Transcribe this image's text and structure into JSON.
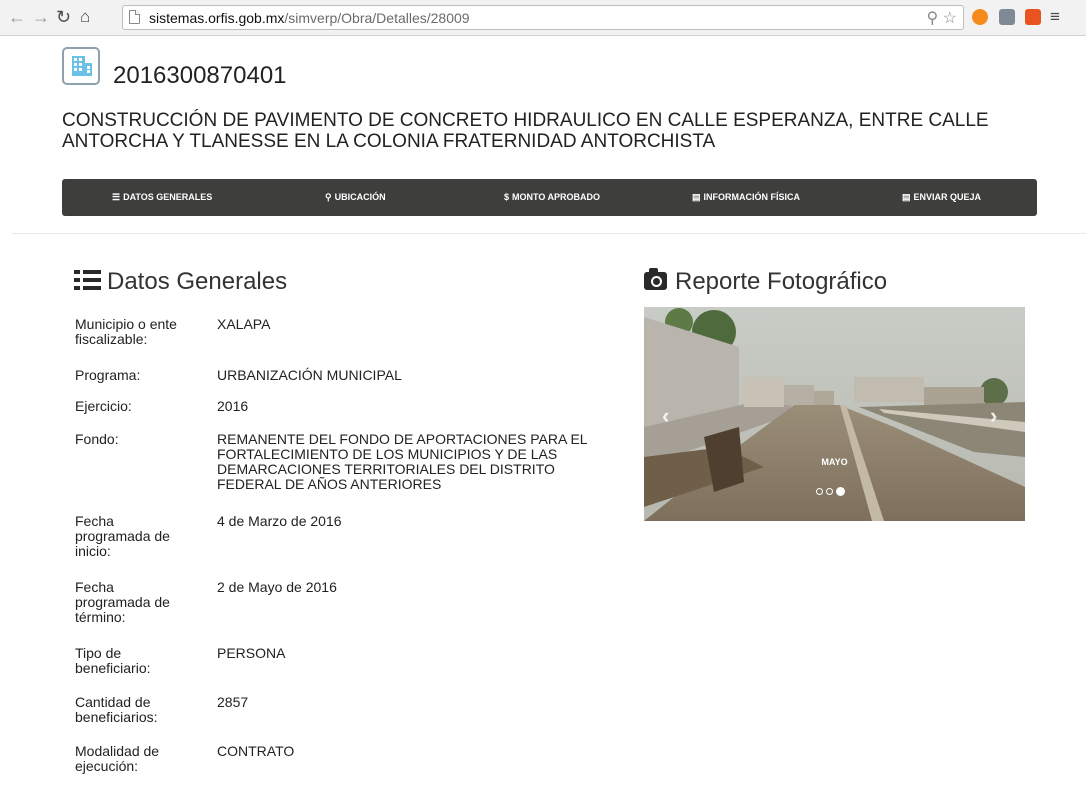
{
  "browser": {
    "url_host": "sistemas.orfis.gob.mx",
    "url_path": "/simverp/Obra/Detalles/28009"
  },
  "header": {
    "obra_id": "2016300870401",
    "title": "CONSTRUCCIÓN DE PAVIMENTO DE CONCRETO HIDRAULICO EN CALLE ESPERANZA, ENTRE CALLE ANTORCHA Y TLANESSE EN LA COLONIA FRATERNIDAD ANTORCHISTA"
  },
  "tabs": [
    {
      "label": "DATOS GENERALES",
      "icon": "list-icon"
    },
    {
      "label": "UBICACIÓN",
      "icon": "map-marker-icon"
    },
    {
      "label": "MONTO APROBADO",
      "icon": "dollar-icon"
    },
    {
      "label": "INFORMACIÓN FÍSICA",
      "icon": "list-alt-icon"
    },
    {
      "label": "ENVIAR QUEJA",
      "icon": "list-alt-icon"
    }
  ],
  "datos": {
    "title": "Datos Generales",
    "fields": [
      {
        "label": "Municipio o ente fiscalizable:",
        "value": "XALAPA"
      },
      {
        "label": "Programa:",
        "value": "URBANIZACIÓN MUNICIPAL"
      },
      {
        "label": "Ejercicio:",
        "value": "2016"
      },
      {
        "label": "Fondo:",
        "value": "REMANENTE DEL FONDO DE APORTACIONES PARA EL FORTALECIMIENTO DE LOS MUNICIPIOS Y DE LAS DEMARCACIONES TERRITORIALES DEL DISTRITO FEDERAL DE AÑOS ANTERIORES"
      },
      {
        "label": "Fecha programada de inicio:",
        "value": "4 de Marzo de 2016"
      },
      {
        "label": "Fecha programada de término:",
        "value": "2 de Mayo de 2016"
      },
      {
        "label": "Tipo de beneficiario:",
        "value": "PERSONA"
      },
      {
        "label": "Cantidad de beneficiarios:",
        "value": "2857"
      },
      {
        "label": "Modalidad de ejecución:",
        "value": "CONTRATO"
      }
    ]
  },
  "reporte": {
    "title": "Reporte Fotográfico",
    "caption": "MAYO",
    "slides": 3,
    "active_slide": 3
  }
}
